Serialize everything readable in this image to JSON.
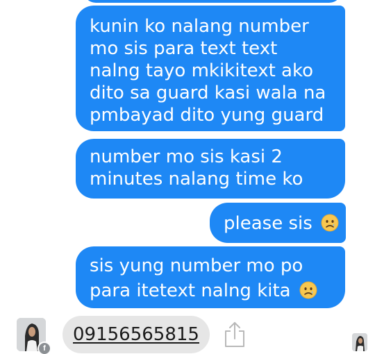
{
  "messages": [
    {
      "text": "kunin ko nalang number mo sis para text text nalng tayo mkikitext ako dito sa guard kasi wala na pmbayad dito yung guard",
      "emoji": ""
    },
    {
      "text": "number mo sis kasi 2 minutes nalang time ko",
      "emoji": ""
    },
    {
      "text": "please sis",
      "emoji": "sad-face-emoji"
    },
    {
      "text": "sis yung number mo po para itetext nalng kita",
      "emoji": "sad-face-emoji"
    }
  ],
  "reply": {
    "number": "09156565815"
  },
  "colors": {
    "bubble": "#1e88f5",
    "pill": "#e6e6e6",
    "emoji_fill": "#f9c74f"
  },
  "icons": {
    "share": "share-icon",
    "badge": "facebook-badge-icon"
  }
}
